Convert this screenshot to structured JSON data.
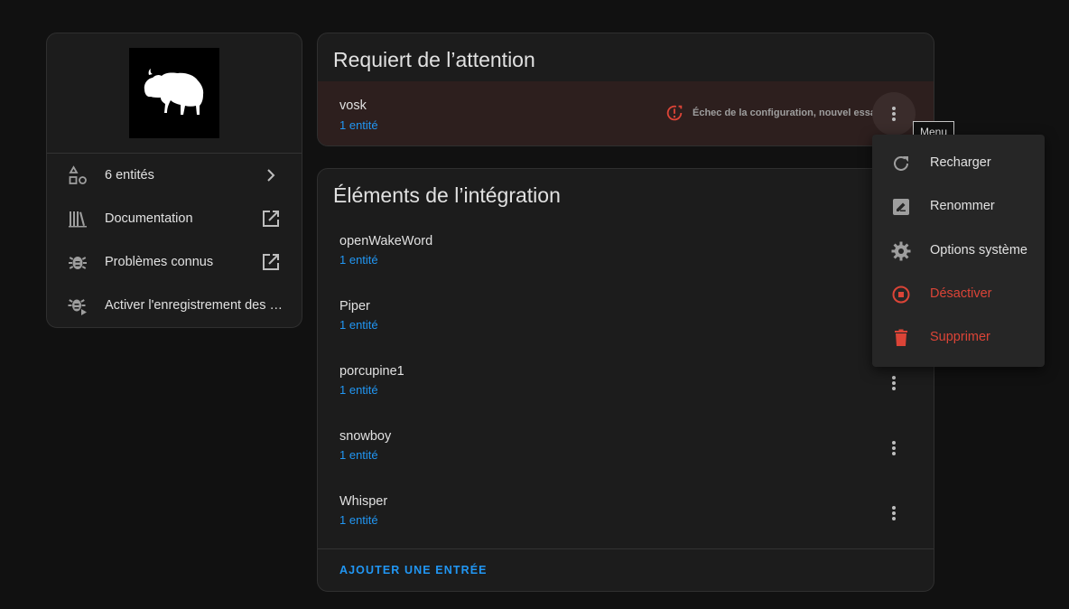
{
  "left_card": {
    "logo_icon": "bison-logo",
    "rows": [
      {
        "label": "6 entités",
        "icon": "shapes-icon",
        "trail_icon": "chevron-right-icon"
      },
      {
        "label": "Documentation",
        "icon": "bookshelf-icon",
        "trail_icon": "open-in-new-icon"
      },
      {
        "label": "Problèmes connus",
        "icon": "bug-icon",
        "trail_icon": "open-in-new-icon"
      },
      {
        "label": "Activer l'enregistrement des jo...",
        "icon": "bug-play-icon"
      }
    ]
  },
  "attention": {
    "title": "Requiert de l’attention",
    "entry": {
      "name": "vosk",
      "sub": "1 entité",
      "status": "Échec de la configuration, nouvel essai",
      "status_icon": "alert-circle-icon"
    }
  },
  "integration": {
    "title": "Éléments de l’intégration",
    "entries": [
      {
        "name": "openWakeWord",
        "sub": "1 entité"
      },
      {
        "name": "Piper",
        "sub": "1 entité"
      },
      {
        "name": "porcupine1",
        "sub": "1 entité"
      },
      {
        "name": "snowboy",
        "sub": "1 entité"
      },
      {
        "name": "Whisper",
        "sub": "1 entité"
      }
    ],
    "add_button": "AJOUTER UNE ENTRÉE"
  },
  "tooltip": "Menu",
  "menu": [
    {
      "label": "Recharger",
      "icon": "reload-icon",
      "danger": false
    },
    {
      "label": "Renommer",
      "icon": "rename-icon",
      "danger": false
    },
    {
      "label": "Options système",
      "icon": "cog-icon",
      "danger": false
    },
    {
      "label": "Désactiver",
      "icon": "stop-circle-icon",
      "danger": true
    },
    {
      "label": "Supprimer",
      "icon": "delete-icon",
      "danger": true
    }
  ],
  "colors": {
    "background": "#111111",
    "card": "#1c1c1c",
    "link": "#2196f3",
    "error": "#db4437",
    "attention_row": "#2d1f1e"
  }
}
